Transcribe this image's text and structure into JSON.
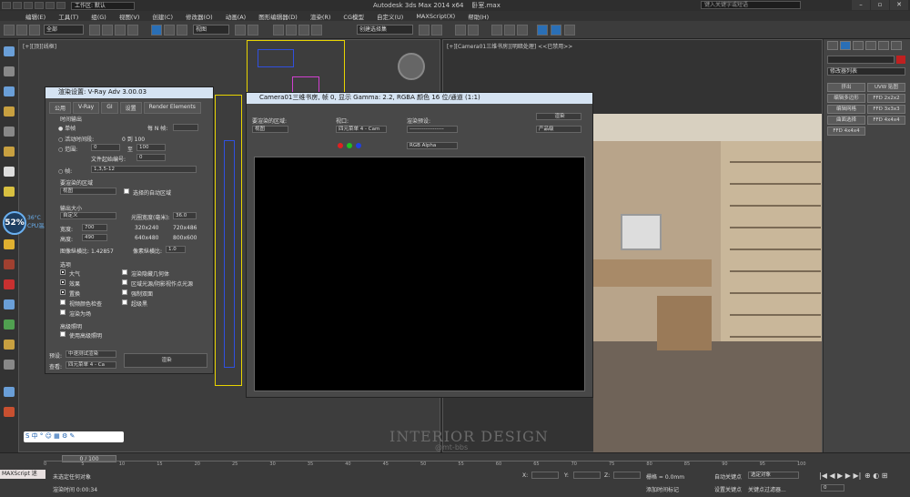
{
  "title": {
    "workspace": "工作区: 默认",
    "app": "Autodesk 3ds Max  2014 x64",
    "file": "卧室.max",
    "search_placeholder": "键入关键字或短语"
  },
  "menu": [
    "编辑(E)",
    "工具(T)",
    "组(G)",
    "视图(V)",
    "创建(C)",
    "修改器(O)",
    "动画(A)",
    "图形编辑器(D)",
    "渲染(R)",
    "CG模型",
    "自定义(U)",
    "MAXScript(X)",
    "帮助(H)"
  ],
  "toolbar": {
    "filter": "全部",
    "view_dd": "视图",
    "selection_set": "创建选择集"
  },
  "viewport_left": {
    "label": "[+][顶][线框]"
  },
  "viewport_right": {
    "label": "[+][Camera01三维书房][明暗处理]  <<已禁用>>"
  },
  "cpu": {
    "percent": "52%",
    "temp": "36°C",
    "label": "CPU温度"
  },
  "vray": {
    "title": "渲染设置: V-Ray Adv 3.00.03",
    "tabs": [
      "公用",
      "V-Ray",
      "GI",
      "设置",
      "Render Elements"
    ],
    "time_output": "时间输出",
    "single": "单帧",
    "every_n": "每 N 帧:",
    "active_segment": "活动时间段:",
    "active_range": "0 到 100",
    "range": "范围:",
    "range_from": "0",
    "range_to": "100",
    "to": "至",
    "file_start": "文件起始编号:",
    "file_start_val": "0",
    "frames": "帧:",
    "frames_val": "1,3,5-12",
    "area_title": "要渲染的区域",
    "area_value": "视图",
    "auto_region": "选择的自动区域",
    "output_size": "输出大小",
    "custom": "自定义",
    "aperture": "光圈宽度(毫米):",
    "aperture_val": "36.0",
    "width_lbl": "宽度:",
    "width_val": "700",
    "height_lbl": "高度:",
    "height_val": "490",
    "presets": [
      "320x240",
      "720x486",
      "640x480",
      "800x600"
    ],
    "image_aspect": "图像纵横比:",
    "image_aspect_val": "1.42857",
    "pixel_aspect": "像素纵横比:",
    "pixel_aspect_val": "1.0",
    "options_title": "选项",
    "options": [
      "大气",
      "渲染隐藏几何体",
      "效果",
      "区域光源/阴影视作点光源",
      "置换",
      "强制双面",
      "视频颜色检查",
      "超级黑",
      "渲染为场"
    ],
    "adv_lighting": "高级照明",
    "use_adv": "使用高级照明",
    "mode_lbl": "预设:",
    "mode_val": "中速测试渲染",
    "view_lbl": "查看:",
    "view_val": "四元菜单 4 - Ca",
    "render_btn": "渲染"
  },
  "render": {
    "title": "Camera01三维书房, 帧 0, 显示 Gamma: 2.2, RGBA 颜色 16 位/通道 (1:1)",
    "area_lbl": "要渲染的区域:",
    "area_val": "视图",
    "viewport_lbl": "视口:",
    "viewport_val": "四元菜单 4 - Cam",
    "preset_lbl": "渲染预设:",
    "preset_val": "-------------------",
    "render_btn": "渲染",
    "product_val": "产品级",
    "channel_val": "RGB Alpha"
  },
  "cmd_panel": {
    "modifier_list": "修改器列表",
    "buttons": [
      "挤出",
      "UVW 贴图",
      "编辑多边形",
      "FFD 2x2x2",
      "编辑网格",
      "FFD 3x3x3",
      "曲面选择",
      "FFD 4x4x4",
      "FFD 4x4x4"
    ]
  },
  "watermark": {
    "main": "INTERIOR DESIGN",
    "sub": "@mt-bbs"
  },
  "bottom": {
    "frame_slider": "0 / 100",
    "maxscript": "MAXScript 迷",
    "status1": "未选定任何对象",
    "status2": "渲染时间  0:00:34",
    "grid": "栅格 = 0.0mm",
    "add_tag": "添加时间标记",
    "auto_key": "自动关键点",
    "selected": "选定对象",
    "set_key": "设置关键点",
    "key_filter": "关键点过滤器...",
    "x_lbl": "X:",
    "y_lbl": "Y:",
    "z_lbl": "Z:",
    "frame_field": "0",
    "ruler_ticks": [
      "0",
      "5",
      "10",
      "15",
      "20",
      "25",
      "30",
      "35",
      "40",
      "45",
      "50",
      "55",
      "60",
      "65",
      "70",
      "75",
      "80",
      "85",
      "90",
      "95",
      "100"
    ]
  }
}
